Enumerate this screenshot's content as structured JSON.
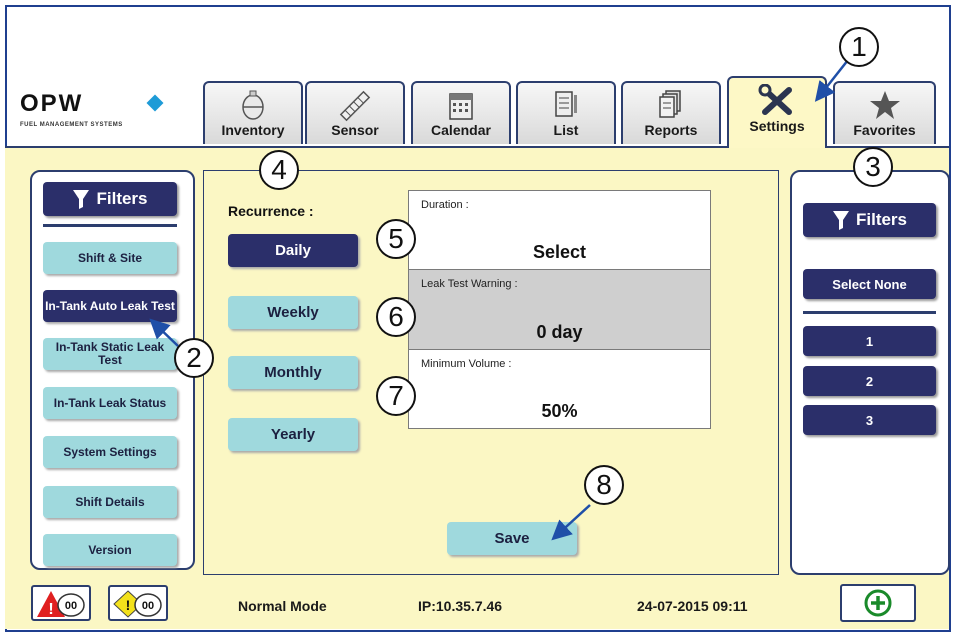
{
  "logo": {
    "text": "OPW",
    "subtitle": "FUEL MANAGEMENT SYSTEMS",
    "accent": "#1e9bd7"
  },
  "tabs": [
    {
      "label": "Inventory",
      "icon": "tank-icon"
    },
    {
      "label": "Sensor",
      "icon": "probe-icon"
    },
    {
      "label": "Calendar",
      "icon": "calendar-icon"
    },
    {
      "label": "List",
      "icon": "list-icon"
    },
    {
      "label": "Reports",
      "icon": "reports-icon"
    },
    {
      "label": "Settings",
      "icon": "tools-icon",
      "active": true
    },
    {
      "label": "Favorites",
      "icon": "star-icon"
    }
  ],
  "left_sidebar": {
    "filters_label": "Filters",
    "items": [
      {
        "label": "Shift & Site"
      },
      {
        "label": "In-Tank Auto Leak Test",
        "active": true
      },
      {
        "label": "In-Tank Static Leak Test"
      },
      {
        "label": "In-Tank Leak Status"
      },
      {
        "label": "System Settings"
      },
      {
        "label": "Shift Details"
      },
      {
        "label": "Version"
      }
    ]
  },
  "recurrence": {
    "label": "Recurrence :",
    "options": [
      {
        "label": "Daily",
        "active": true
      },
      {
        "label": "Weekly"
      },
      {
        "label": "Monthly"
      },
      {
        "label": "Yearly"
      }
    ]
  },
  "fields": {
    "duration": {
      "label": "Duration :",
      "value": "Select"
    },
    "leak_warning": {
      "label": "Leak Test Warning :",
      "value": "0 day"
    },
    "min_volume": {
      "label": "Minimum Volume :",
      "value": "50%"
    }
  },
  "save_label": "Save",
  "right_sidebar": {
    "filters_label": "Filters",
    "select_none": "Select None",
    "items": [
      "1",
      "2",
      "3"
    ]
  },
  "status_bar": {
    "alarm_count": "00",
    "warning_count": "00",
    "mode": "Normal Mode",
    "ip": "IP:10.35.7.46",
    "datetime": "24-07-2015 09:11"
  },
  "callouts": [
    "1",
    "2",
    "3",
    "4",
    "5",
    "6",
    "7",
    "8"
  ],
  "colors": {
    "navy": "#2b2f6a",
    "teal_button": "#9fd9dd",
    "panel_bg": "#fbf7c4",
    "border": "#2c3e6e"
  }
}
